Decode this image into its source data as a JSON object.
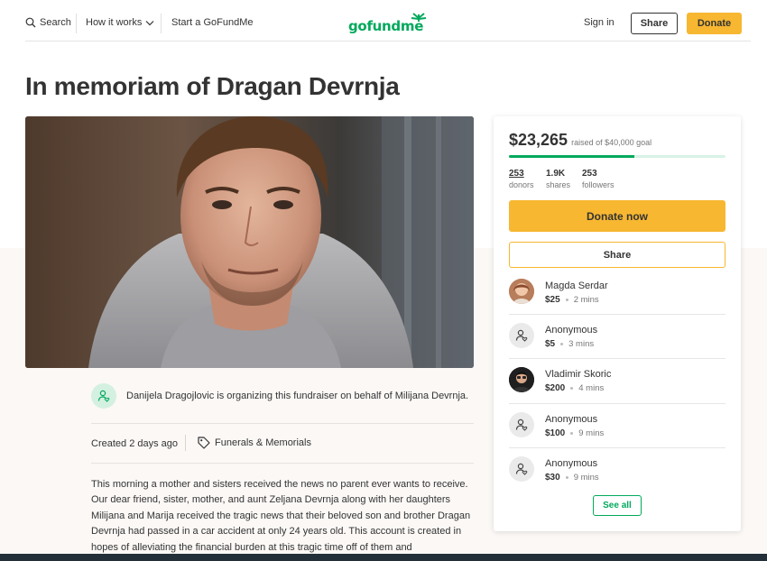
{
  "header": {
    "search_label": "Search",
    "how_label": "How it works",
    "start_label": "Start a GoFundMe",
    "logo_text": "gofundme",
    "signin_label": "Sign in",
    "share_label": "Share",
    "donate_label": "Donate"
  },
  "campaign": {
    "title": "In memoriam of Dragan Devrnja",
    "organizer_text": "Danijela Dragojlovic is organizing this fundraiser on behalf of Milijana Devrnja.",
    "created": "Created 2 days ago",
    "category": "Funerals & Memorials",
    "story": "This morning a mother and sisters received the news no parent ever wants to receive. Our dear friend, sister, mother, and aunt Zeljana Devrnja along with her daughters Milijana and Marija received the tragic news that their beloved son and brother Dragan Devrnja had passed in a car accident at only 24 years old. This account is created in hopes of alleviating the financial burden at this tragic time off of them and"
  },
  "sidebar": {
    "raised": "$23,265",
    "goal_text": "raised of $40,000 goal",
    "progress_fraction": 0.58,
    "stats": [
      {
        "num": "253",
        "label": "donors"
      },
      {
        "num": "1.9K",
        "label": "shares"
      },
      {
        "num": "253",
        "label": "followers"
      }
    ],
    "donate_now_label": "Donate now",
    "share_label": "Share",
    "donations": [
      {
        "name": "Magda Serdar",
        "amount": "$25",
        "time": "2 mins"
      },
      {
        "name": "Anonymous",
        "amount": "$5",
        "time": "3 mins"
      },
      {
        "name": "Vladimir Skoric",
        "amount": "$200",
        "time": "4 mins"
      },
      {
        "name": "Anonymous",
        "amount": "$100",
        "time": "9 mins"
      },
      {
        "name": "Anonymous",
        "amount": "$30",
        "time": "9 mins"
      }
    ],
    "see_all_label": "See all"
  },
  "colors": {
    "brand_green": "#02a95c",
    "donate_yellow": "#f7b731",
    "beige": "#fbf8f6"
  }
}
